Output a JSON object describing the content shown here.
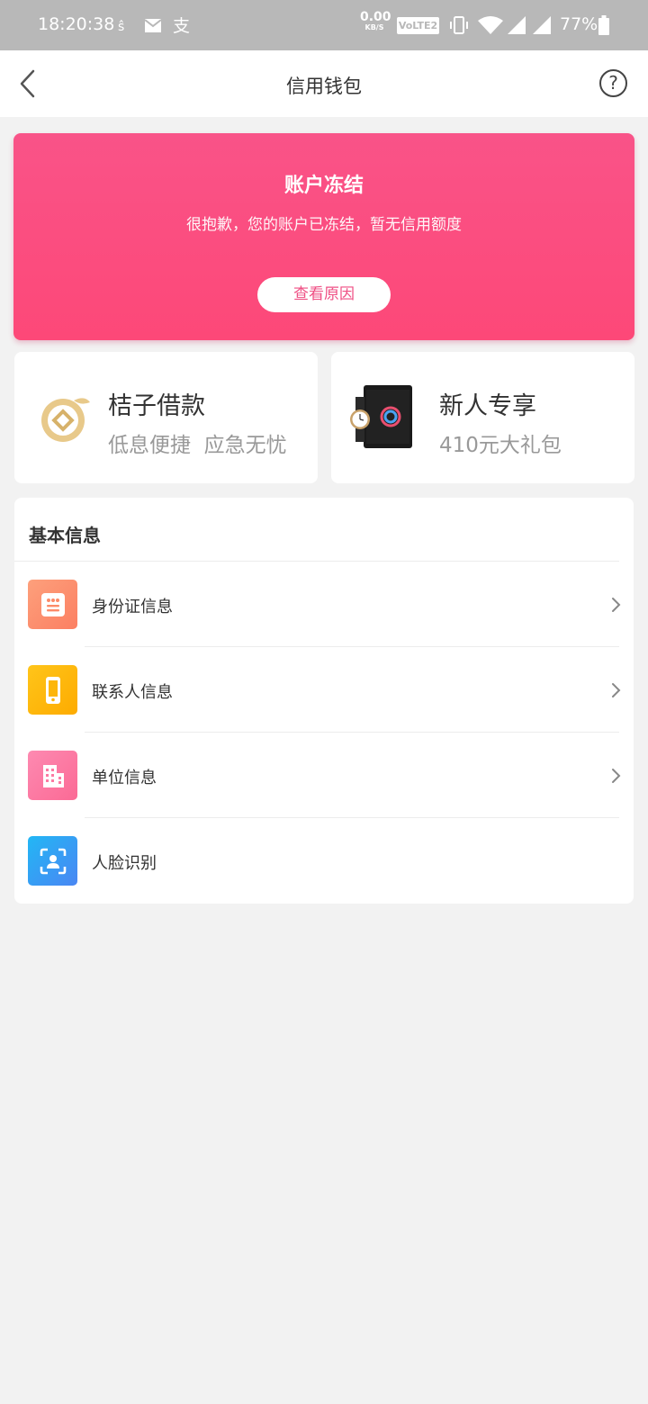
{
  "status_bar": {
    "time": "18:20:38",
    "net_speed_value": "0.00",
    "net_speed_unit": "KB/S",
    "volte": "VoLTE2",
    "battery_percent": "77%"
  },
  "nav": {
    "title": "信用钱包",
    "help_label": "?"
  },
  "banner": {
    "title": "账户冻结",
    "subtitle": "很抱歉，您的账户已冻结，暂无信用额度",
    "button": "查看原因"
  },
  "promos": [
    {
      "title": "桔子借款",
      "subtitle": "低息便捷  应急无忧"
    },
    {
      "title": "新人专享",
      "subtitle": "410元大礼包"
    }
  ],
  "basic_info": {
    "header": "基本信息",
    "items": [
      {
        "label": "身份证信息",
        "icon": "id-card-icon",
        "color": "#fd8d6c",
        "has_arrow": true
      },
      {
        "label": "联系人信息",
        "icon": "phone-icon",
        "color": "#fdb100",
        "has_arrow": true
      },
      {
        "label": "单位信息",
        "icon": "building-icon",
        "color": "#fb6e9b",
        "has_arrow": true
      },
      {
        "label": "人脸识别",
        "icon": "face-scan-icon",
        "color": "#2d9cf7",
        "has_arrow": false
      }
    ]
  },
  "colors": {
    "banner_gradient_top": "#f95388",
    "banner_gradient_bottom": "#fd4878",
    "accent_text": "#ef4f84",
    "page_bg": "#f2f2f2"
  }
}
